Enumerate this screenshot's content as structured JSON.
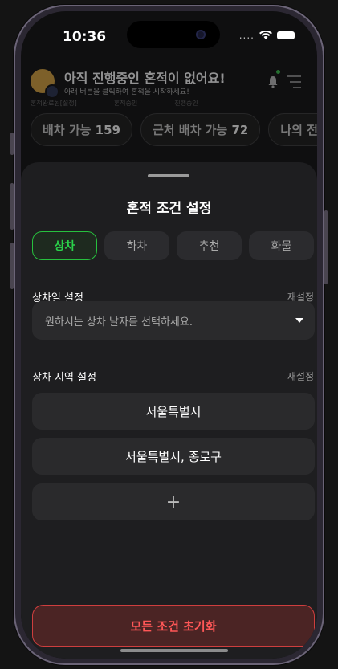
{
  "status": {
    "time": "10:36",
    "signal_dots": "...."
  },
  "background": {
    "title": "아직 진행중인 혼적이 없어요!",
    "subtitle": "아래 버튼을 클릭하여 혼적을 시작하세요!",
    "faint_labels": [
      "혼적완료됨[설정]",
      "혼적중인",
      "진행중인"
    ],
    "chips": [
      {
        "label": "배차 가능",
        "count": "159"
      },
      {
        "label": "근처 배차 가능",
        "count": "72"
      },
      {
        "label": "나의 전체",
        "count": ""
      }
    ]
  },
  "sheet": {
    "title": "혼적 조건 설정",
    "tabs": [
      {
        "label": "상차",
        "active": true
      },
      {
        "label": "하차",
        "active": false
      },
      {
        "label": "추천",
        "active": false
      },
      {
        "label": "화물",
        "active": false
      }
    ],
    "date_section": {
      "label": "상차일 설정",
      "reset": "재설정",
      "placeholder": "원하시는 상차 날자를 선택하세요."
    },
    "region_section": {
      "label": "상차 지역 설정",
      "reset": "재설정",
      "regions": [
        "서울특별시",
        "서울특별시, 종로구"
      ],
      "add": "+"
    },
    "reset_all": "모든 조건 초기화"
  },
  "colors": {
    "accent_green": "#2ad24a",
    "danger_red": "#ff5757",
    "sheet_bg": "#1e1e20"
  }
}
